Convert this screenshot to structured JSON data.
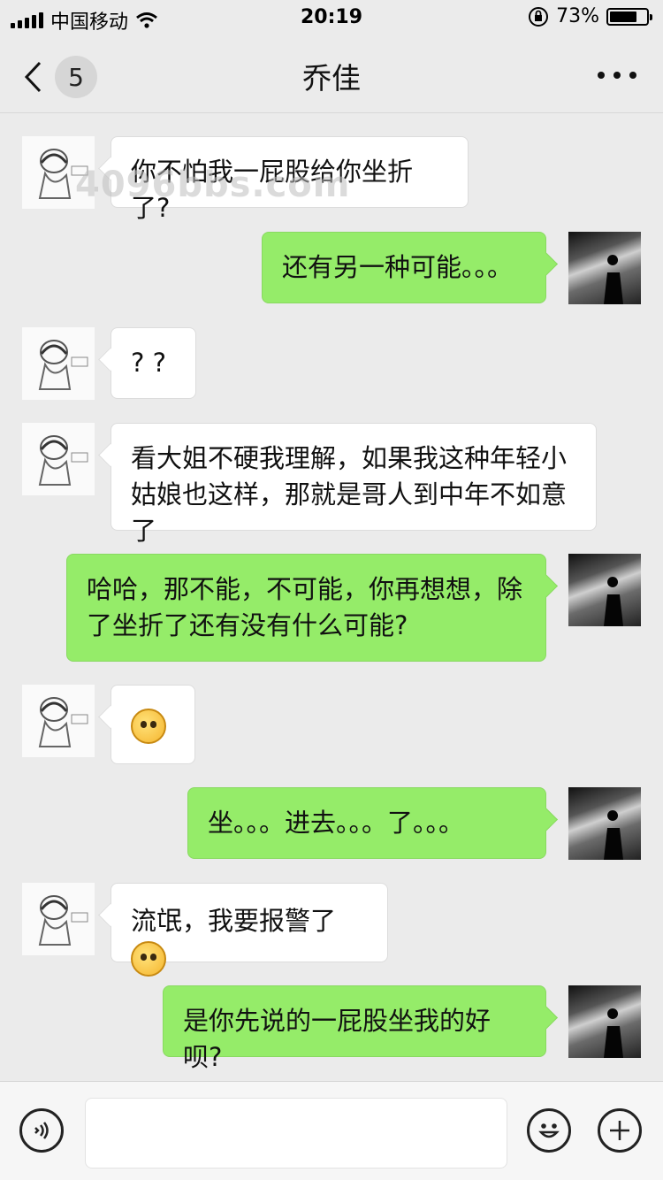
{
  "status_bar": {
    "carrier": "中国移动",
    "time": "20:19",
    "battery_percent": "73%",
    "battery_level": 0.73
  },
  "nav": {
    "unread_count": "5",
    "title": "乔佳"
  },
  "watermark": "4096bbs.com",
  "messages": [
    {
      "side": "left",
      "text": "你不怕我一屁股给你坐折了?"
    },
    {
      "side": "right",
      "text": "还有另一种可能。。。"
    },
    {
      "side": "left",
      "text": "? ?"
    },
    {
      "side": "left",
      "text": "看大姐不硬我理解，如果我这种年轻小姑娘也这样，那就是哥人到中年不如意了"
    },
    {
      "side": "right",
      "text": "哈哈，那不能，不可能，你再想想，除了坐折了还有没有什么可能?"
    },
    {
      "side": "left",
      "text": "",
      "emoji": "confused-face"
    },
    {
      "side": "right",
      "text": "坐。。。进去。。。了。。。"
    },
    {
      "side": "left",
      "text": "流氓，我要报警了",
      "emoji": "scared-face"
    },
    {
      "side": "right",
      "text": "是你先说的一屁股坐我的好呗?"
    }
  ],
  "colors": {
    "sent_bubble": "#95ec69",
    "received_bubble": "#ffffff",
    "background": "#ebebeb"
  }
}
